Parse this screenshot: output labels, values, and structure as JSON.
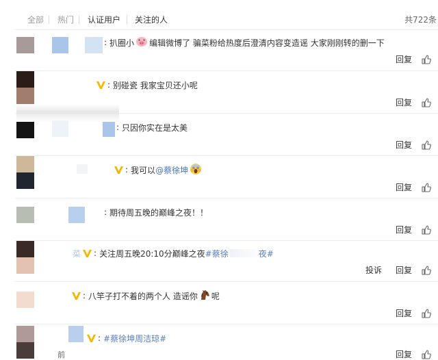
{
  "filter_bar": {
    "tabs": [
      "全部",
      "热门",
      "认证用户",
      "关注的人"
    ],
    "total_count": "共722条"
  },
  "actions": {
    "reply": "回复",
    "report": "投诉"
  },
  "comments": [
    {
      "name": "",
      "text": "扒圈小",
      "emoji": "pig-face-emoji",
      "text2": "编辑微博了 骗菜粉给热度后澄清内容变造谣 大家刚刚转的删一下"
    },
    {
      "name": "",
      "text": "别碰瓷 我家宝贝还小呢"
    },
    {
      "name": "",
      "text": "只因你实在是太美"
    },
    {
      "name": "",
      "text": "我可以",
      "mention": "@蔡徐坤",
      "emoji": "scream-face-emoji"
    },
    {
      "name": "",
      "text": "期待周五晚的巅峰之夜！！"
    },
    {
      "name": "菜",
      "text": "关注周五晚20:10分巅峰之夜",
      "hashtag": "#蔡徐",
      "hashtag_tail": "夜#"
    },
    {
      "name": "",
      "text": "八竿子打不着的两个人 造谣你",
      "emoji": "horse-face-emoji",
      "text2": "呢"
    },
    {
      "name": "",
      "hashtag": "#蔡徐坤周洁琼#",
      "time": "前"
    }
  ],
  "colors": {
    "accent_link": "#4a76b8",
    "vip_badge": "#f5b800",
    "rule": "#ececec"
  }
}
